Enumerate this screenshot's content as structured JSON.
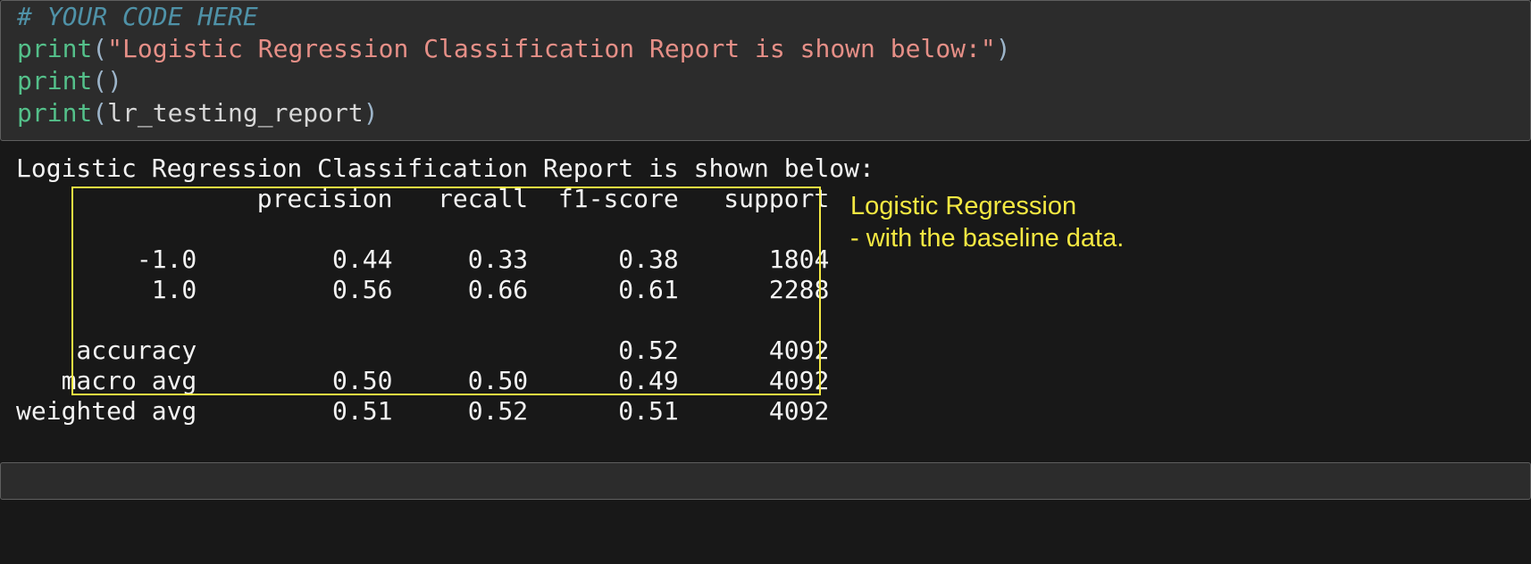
{
  "code": {
    "comment": "# YOUR CODE HERE",
    "fn1": "print",
    "p_open": "(",
    "str": "\"Logistic Regression Classification Report is shown below:\"",
    "p_close": ")",
    "fn2": "print",
    "empty_args": "()",
    "fn3": "print",
    "var": "lr_testing_report"
  },
  "chart_data": {
    "type": "table",
    "title_line": "Logistic Regression Classification Report is shown below:",
    "columns": [
      "",
      "precision",
      "recall",
      "f1-score",
      "support"
    ],
    "rows": [
      {
        "label": "-1.0",
        "precision": "0.44",
        "recall": "0.33",
        "f1": "0.38",
        "support": "1804"
      },
      {
        "label": "1.0",
        "precision": "0.56",
        "recall": "0.66",
        "f1": "0.61",
        "support": "2288"
      }
    ],
    "summary": [
      {
        "label": "accuracy",
        "precision": "",
        "recall": "",
        "f1": "0.52",
        "support": "4092"
      },
      {
        "label": "macro avg",
        "precision": "0.50",
        "recall": "0.50",
        "f1": "0.49",
        "support": "4092"
      },
      {
        "label": "weighted avg",
        "precision": "0.51",
        "recall": "0.52",
        "f1": "0.51",
        "support": "4092"
      }
    ]
  },
  "annotation": {
    "line1": "Logistic  Regression",
    "line2": "- with the baseline data."
  }
}
